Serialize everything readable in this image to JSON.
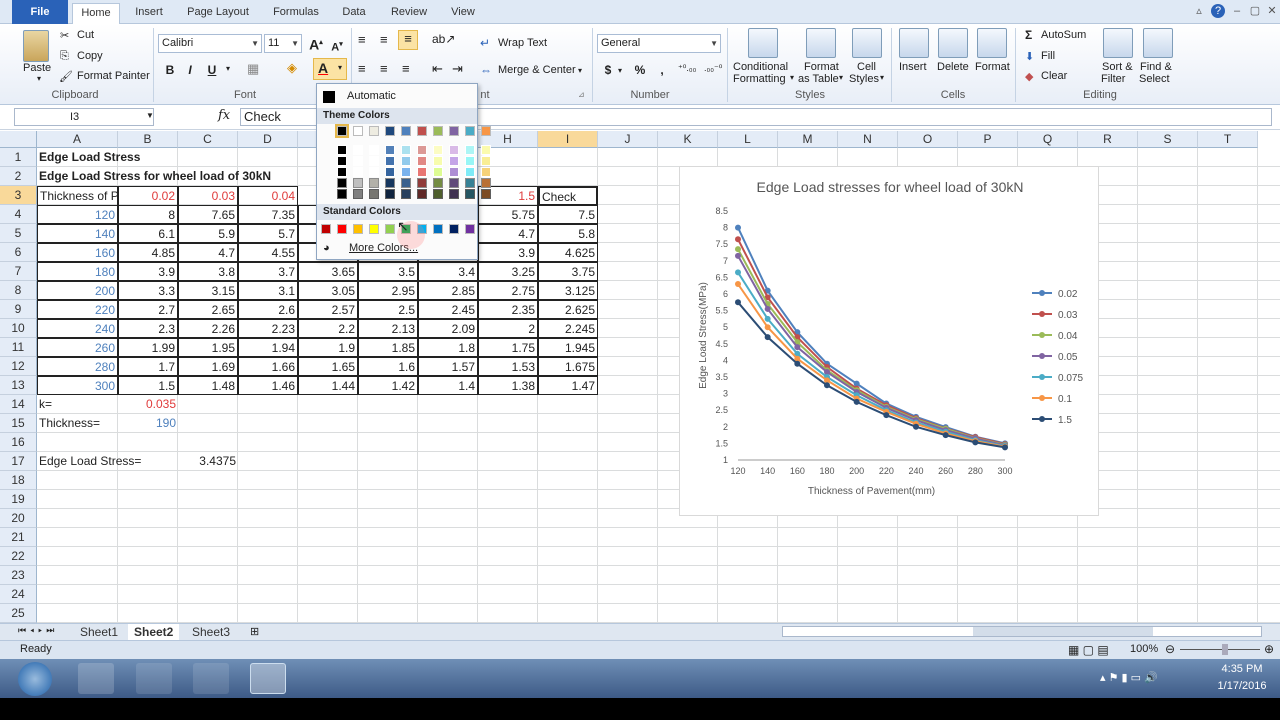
{
  "tabs": {
    "file": "File",
    "home": "Home",
    "insert": "Insert",
    "page_layout": "Page Layout",
    "formulas": "Formulas",
    "data": "Data",
    "review": "Review",
    "view": "View"
  },
  "clipboard": {
    "paste": "Paste",
    "cut": "Cut",
    "copy": "Copy",
    "format_painter": "Format Painter",
    "label": "Clipboard"
  },
  "font": {
    "name": "Calibri",
    "size": "11",
    "label": "Font",
    "bold": "B",
    "italic": "I",
    "underline": "U"
  },
  "alignment": {
    "wrap_text": "Wrap Text",
    "merge_center": "Merge & Center",
    "label": "nt"
  },
  "number": {
    "format": "General",
    "currency": "$",
    "percent": "%",
    "comma": ",",
    "label": "Number"
  },
  "styles": {
    "conditional": "Conditional",
    "formatting": "Formatting",
    "format_as": "Format",
    "as_table": "as Table",
    "cell": "Cell",
    "cell_styles": "Styles",
    "label": "Styles"
  },
  "cells": {
    "insert": "Insert",
    "delete": "Delete",
    "format": "Format",
    "label": "Cells"
  },
  "editing": {
    "autosum": "AutoSum",
    "fill": "Fill",
    "clear": "Clear",
    "sort": "Sort &",
    "filter": "Filter",
    "find": "Find &",
    "select": "Select",
    "label": "Editing"
  },
  "formula_bar": {
    "name_box": "I3",
    "fx": "fx",
    "value": "Check"
  },
  "color_menu": {
    "automatic": "Automatic",
    "theme_colors": "Theme Colors",
    "standard_colors": "Standard Colors",
    "more_colors": "More Colors..."
  },
  "theme_top": [
    "#000000",
    "#ffffff",
    "#eeece1",
    "#1f497d",
    "#4f81bd",
    "#c0504d",
    "#9bbb59",
    "#8064a2",
    "#4bacc6",
    "#f79646"
  ],
  "standard": [
    "#c00000",
    "#ff0000",
    "#ffc000",
    "#ffff00",
    "#92d050",
    "#00b050",
    "#00b0f0",
    "#0070c0",
    "#002060",
    "#7030a0"
  ],
  "columns": [
    "A",
    "B",
    "C",
    "D",
    "E",
    "F",
    "G",
    "H",
    "I",
    "J",
    "K",
    "L",
    "M",
    "N",
    "O",
    "P",
    "Q",
    "R",
    "S",
    "T"
  ],
  "rows": [
    "1",
    "2",
    "3",
    "4",
    "5",
    "6",
    "7",
    "8",
    "9",
    "10",
    "11",
    "12",
    "13",
    "14",
    "15",
    "16",
    "17",
    "18",
    "19",
    "20",
    "21",
    "22",
    "23",
    "24",
    "25",
    "26"
  ],
  "sheet": {
    "a1": "Edge Load Stress",
    "a2": "Edge Load Stress for wheel load of 30kN",
    "a3": "Thickness of P",
    "header_k": [
      "0.02",
      "0.03",
      "0.04"
    ],
    "h3": "1.5",
    "i3": "Check",
    "table": [
      {
        "t": "120",
        "b": "8",
        "c": "7.65",
        "d": "7.35",
        "e": "",
        "f": "",
        "g": "",
        "h": "5.75",
        "i": "7.5"
      },
      {
        "t": "140",
        "b": "6.1",
        "c": "5.9",
        "d": "5.7",
        "e": "",
        "f": "",
        "g": "",
        "h": "4.7",
        "i": "5.8"
      },
      {
        "t": "160",
        "b": "4.85",
        "c": "4.7",
        "d": "4.55",
        "e": "",
        "f": "",
        "g": "",
        "h": "3.9",
        "i": "4.625"
      },
      {
        "t": "180",
        "b": "3.9",
        "c": "3.8",
        "d": "3.7",
        "e": "3.65",
        "f": "3.5",
        "g": "3.4",
        "h": "3.25",
        "i": "3.75"
      },
      {
        "t": "200",
        "b": "3.3",
        "c": "3.15",
        "d": "3.1",
        "e": "3.05",
        "f": "2.95",
        "g": "2.85",
        "h": "2.75",
        "i": "3.125"
      },
      {
        "t": "220",
        "b": "2.7",
        "c": "2.65",
        "d": "2.6",
        "e": "2.57",
        "f": "2.5",
        "g": "2.45",
        "h": "2.35",
        "i": "2.625"
      },
      {
        "t": "240",
        "b": "2.3",
        "c": "2.26",
        "d": "2.23",
        "e": "2.2",
        "f": "2.13",
        "g": "2.09",
        "h": "2",
        "i": "2.245"
      },
      {
        "t": "260",
        "b": "1.99",
        "c": "1.95",
        "d": "1.94",
        "e": "1.9",
        "f": "1.85",
        "g": "1.8",
        "h": "1.75",
        "i": "1.945"
      },
      {
        "t": "280",
        "b": "1.7",
        "c": "1.69",
        "d": "1.66",
        "e": "1.65",
        "f": "1.6",
        "g": "1.57",
        "h": "1.53",
        "i": "1.675"
      },
      {
        "t": "300",
        "b": "1.5",
        "c": "1.48",
        "d": "1.46",
        "e": "1.44",
        "f": "1.42",
        "g": "1.4",
        "h": "1.38",
        "i": "1.47"
      }
    ],
    "a14": "k=",
    "b14": "0.035",
    "a15": "Thickness=",
    "b15": "190",
    "a17": "Edge Load Stress=",
    "c17": "3.4375"
  },
  "chart_data": {
    "type": "line",
    "title": "Edge Load stresses for wheel load of 30kN",
    "xlabel": "Thickness of Pavement(mm)",
    "ylabel": "Edge Load Stress(MPa)",
    "x": [
      120,
      140,
      160,
      180,
      200,
      220,
      240,
      260,
      280,
      300
    ],
    "yticks": [
      "1",
      "1.5",
      "2",
      "2.5",
      "3",
      "3.5",
      "4",
      "4.5",
      "5",
      "5.5",
      "6",
      "6.5",
      "7",
      "7.5",
      "8",
      "8.5"
    ],
    "ylim": [
      1,
      8.5
    ],
    "legend_position": "right",
    "series": [
      {
        "name": "0.02",
        "color": "#4f81bd",
        "values": [
          8,
          6.1,
          4.85,
          3.9,
          3.3,
          2.7,
          2.3,
          1.99,
          1.7,
          1.5
        ]
      },
      {
        "name": "0.03",
        "color": "#c0504d",
        "values": [
          7.65,
          5.9,
          4.7,
          3.8,
          3.15,
          2.65,
          2.26,
          1.95,
          1.69,
          1.48
        ]
      },
      {
        "name": "0.04",
        "color": "#9bbb59",
        "values": [
          7.35,
          5.7,
          4.55,
          3.7,
          3.1,
          2.6,
          2.23,
          1.94,
          1.66,
          1.46
        ]
      },
      {
        "name": "0.05",
        "color": "#8064a2",
        "values": [
          7.15,
          5.55,
          4.4,
          3.65,
          3.05,
          2.57,
          2.2,
          1.9,
          1.65,
          1.44
        ]
      },
      {
        "name": "0.075",
        "color": "#4bacc6",
        "values": [
          6.65,
          5.25,
          4.2,
          3.5,
          2.95,
          2.5,
          2.13,
          1.85,
          1.6,
          1.42
        ]
      },
      {
        "name": "0.1",
        "color": "#f79646",
        "values": [
          6.3,
          5.0,
          4.05,
          3.4,
          2.85,
          2.45,
          2.09,
          1.8,
          1.57,
          1.4
        ]
      },
      {
        "name": "1.5",
        "color": "#2c4d75",
        "values": [
          5.75,
          4.7,
          3.9,
          3.25,
          2.75,
          2.35,
          2.0,
          1.75,
          1.53,
          1.38
        ]
      }
    ]
  },
  "sheets": [
    "Sheet1",
    "Sheet2",
    "Sheet3"
  ],
  "status": {
    "ready": "Ready",
    "zoom": "100%"
  },
  "clock": {
    "time": "4:35 PM",
    "date": "1/17/2016"
  }
}
